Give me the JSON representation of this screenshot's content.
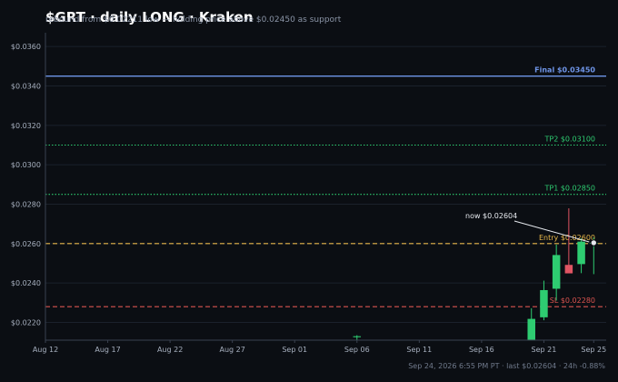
{
  "title": "$GRT · daily LONG · Kraken",
  "subtitle": "rebound from $0.02211 low — holding price above $0.02450 as support",
  "footer": "Sep 24, 2026 6:55 PM PT · last $0.02604 · 24h -0.88%",
  "colors": {
    "background": "#0b0e13",
    "grid": "#1b212b",
    "up": "#2ecc71",
    "down": "#e05563",
    "final": "#6f95e8",
    "tp": "#2ecc71",
    "entry": "#e8b84a",
    "sl": "#d9534f"
  },
  "chart_data": {
    "type": "candlestick",
    "ylim": [
      0.0211,
      0.0367
    ],
    "yticks": [
      "$0.0220",
      "$0.0240",
      "$0.0260",
      "$0.0280",
      "$0.0300",
      "$0.0320",
      "$0.0340",
      "$0.0360"
    ],
    "ytick_values": [
      0.022,
      0.024,
      0.026,
      0.028,
      0.03,
      0.032,
      0.034,
      0.036
    ],
    "x_range": [
      "2026-08-12",
      "2026-09-26"
    ],
    "xticks": [
      {
        "date": "2026-08-12",
        "label": "Aug 12"
      },
      {
        "date": "2026-08-17",
        "label": "Aug 17"
      },
      {
        "date": "2026-08-22",
        "label": "Aug 22"
      },
      {
        "date": "2026-08-27",
        "label": "Aug 27"
      },
      {
        "date": "2026-09-01",
        "label": "Sep 01"
      },
      {
        "date": "2026-09-06",
        "label": "Sep 06"
      },
      {
        "date": "2026-09-11",
        "label": "Sep 11"
      },
      {
        "date": "2026-09-16",
        "label": "Sep 16"
      },
      {
        "date": "2026-09-21",
        "label": "Sep 21"
      },
      {
        "date": "2026-09-25",
        "label": "Sep 25"
      }
    ],
    "candles": [
      {
        "date": "2026-09-06",
        "open": 0.02125,
        "high": 0.02135,
        "low": 0.0211,
        "close": 0.0213
      },
      {
        "date": "2026-09-20",
        "open": 0.0211,
        "high": 0.02272,
        "low": 0.0211,
        "close": 0.02218
      },
      {
        "date": "2026-09-21",
        "open": 0.02226,
        "high": 0.02412,
        "low": 0.02211,
        "close": 0.02364
      },
      {
        "date": "2026-09-22",
        "open": 0.02371,
        "high": 0.02595,
        "low": 0.02311,
        "close": 0.02542
      },
      {
        "date": "2026-09-23",
        "open": 0.02492,
        "high": 0.02779,
        "low": 0.02474,
        "close": 0.02449
      },
      {
        "date": "2026-09-24",
        "open": 0.02496,
        "high": 0.02627,
        "low": 0.0245,
        "close": 0.0261
      },
      {
        "date": "2026-09-25",
        "open": 0.02604,
        "high": 0.02631,
        "low": 0.02445,
        "close": 0.02604
      }
    ],
    "levels": [
      {
        "name": "final",
        "label": "Final $0.03450",
        "value": 0.0345,
        "style": "solid"
      },
      {
        "name": "tp2",
        "label": "TP2 $0.03100",
        "value": 0.031,
        "style": "dotted"
      },
      {
        "name": "tp1",
        "label": "TP1 $0.02850",
        "value": 0.0285,
        "style": "dotted"
      },
      {
        "name": "entry",
        "label": "Entry $0.02600",
        "value": 0.026,
        "style": "dashed"
      },
      {
        "name": "sl",
        "label": "SL $0.02280",
        "value": 0.0228,
        "style": "dashed"
      }
    ],
    "annotation": {
      "label": "now $0.02604",
      "date": "2026-09-25",
      "value": 0.02604
    }
  }
}
